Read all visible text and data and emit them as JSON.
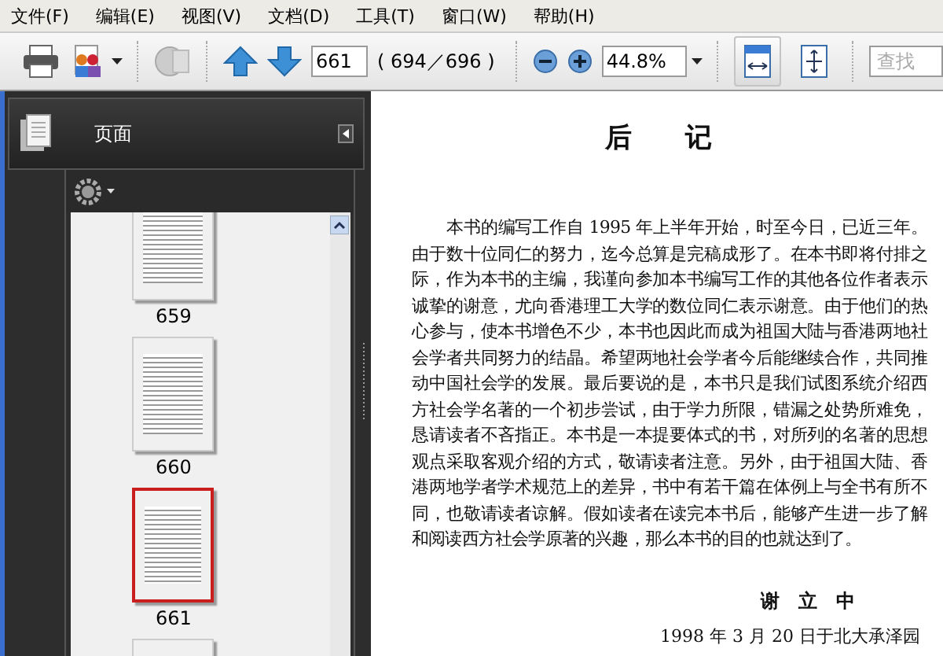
{
  "menu": [
    {
      "label": "文件(F)"
    },
    {
      "label": "编辑(E)"
    },
    {
      "label": "视图(V)"
    },
    {
      "label": "文档(D)"
    },
    {
      "label": "工具(T)"
    },
    {
      "label": "窗口(W)"
    },
    {
      "label": "帮助(H)"
    }
  ],
  "toolbar": {
    "page_field": {
      "value": "661"
    },
    "page_count": "( 694／696 )",
    "zoom_field": {
      "value": "44.8%"
    },
    "fit_width": {
      "selected": true
    },
    "fit_page": {
      "selected": false
    },
    "search": {
      "placeholder": "查找"
    }
  },
  "sidebar": {
    "title": "页面",
    "thumbnails": [
      {
        "label": "659",
        "selected": false
      },
      {
        "label": "660",
        "selected": false
      },
      {
        "label": "661",
        "selected": true
      },
      {
        "selected": false
      }
    ]
  },
  "document": {
    "title": "后　　记",
    "paragraph": "本书的编写工作自 1995 年上半年开始，时至今日，已近三年。由于数十位同仁的努力，迄今总算是完稿成形了。在本书即将付排之际，作为本书的主编，我谨向参加本书编写工作的其他各位作者表示诚挚的谢意，尤向香港理工大学的数位同仁表示谢意。由于他们的热心参与，使本书增色不少，本书也因此而成为祖国大陆与香港两地社会学者共同努力的结晶。希望两地社会学者今后能继续合作，共同推动中国社会学的发展。最后要说的是，本书只是我们试图系统介绍西方社会学名著的一个初步尝试，由于学力所限，错漏之处势所难免，恳请读者不吝指正。本书是一本提要体式的书，对所列的名著的思想观点采取客观介绍的方式，敬请读者注意。另外，由于祖国大陆、香港两地学者学术规范上的差异，书中有若干篇在体例上与全书有所不同，也敬请读者谅解。假如读者在读完本书后，能够产生进一步了解和阅读西方社会学原著的兴趣，那么本书的目的也就达到了。",
    "signature": "谢　立　中",
    "date": "1998 年 3 月 20 日于北大承泽园"
  }
}
